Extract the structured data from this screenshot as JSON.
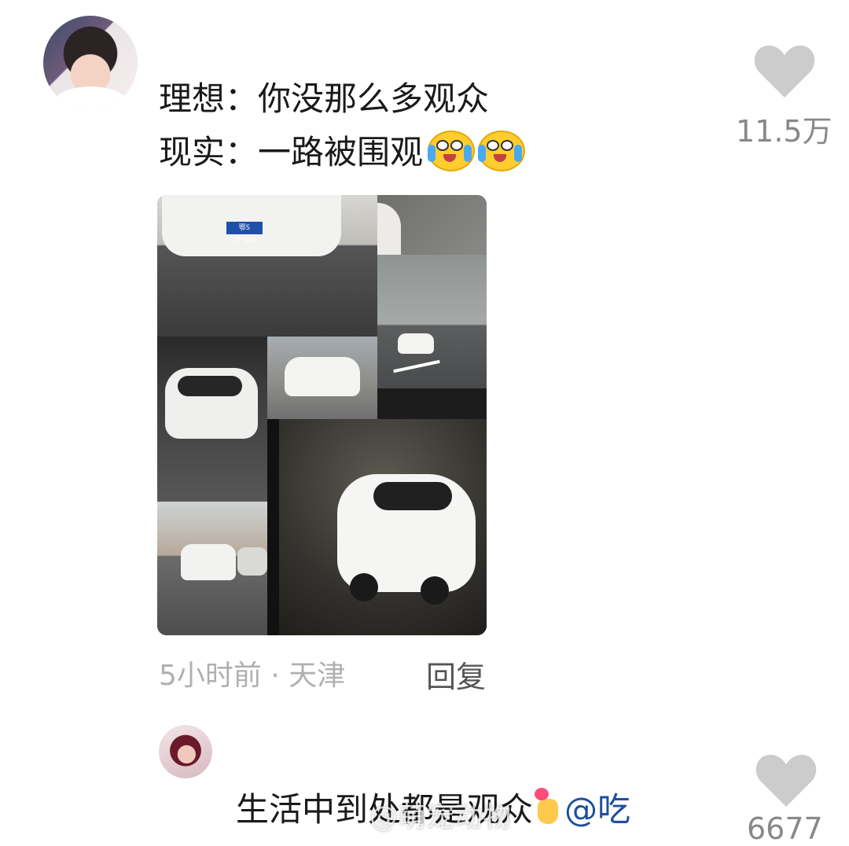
{
  "comment1": {
    "avatar_alt": "user avatar",
    "line1": "理想：你没那么多观众",
    "line2": "现实：一路被围观",
    "emoji": [
      "crying-laughing-emoji",
      "crying-laughing-emoji"
    ],
    "likes": "11.5万",
    "image": {
      "plate_text": "鄂S ZF980"
    },
    "time": "5小时前",
    "separator": "·",
    "location": "天津",
    "reply_label": "回复"
  },
  "comment2": {
    "text": "生活中到处都是观众",
    "emoji": "finger-heart-emoji",
    "mention": "@吃",
    "likes": "6677",
    "watermark": "@萌宠动物"
  },
  "colors": {
    "text": "#1a1a1a",
    "meta": "#b0b0b0",
    "like_icon": "#cccccc",
    "mention": "#1e4f9c"
  }
}
